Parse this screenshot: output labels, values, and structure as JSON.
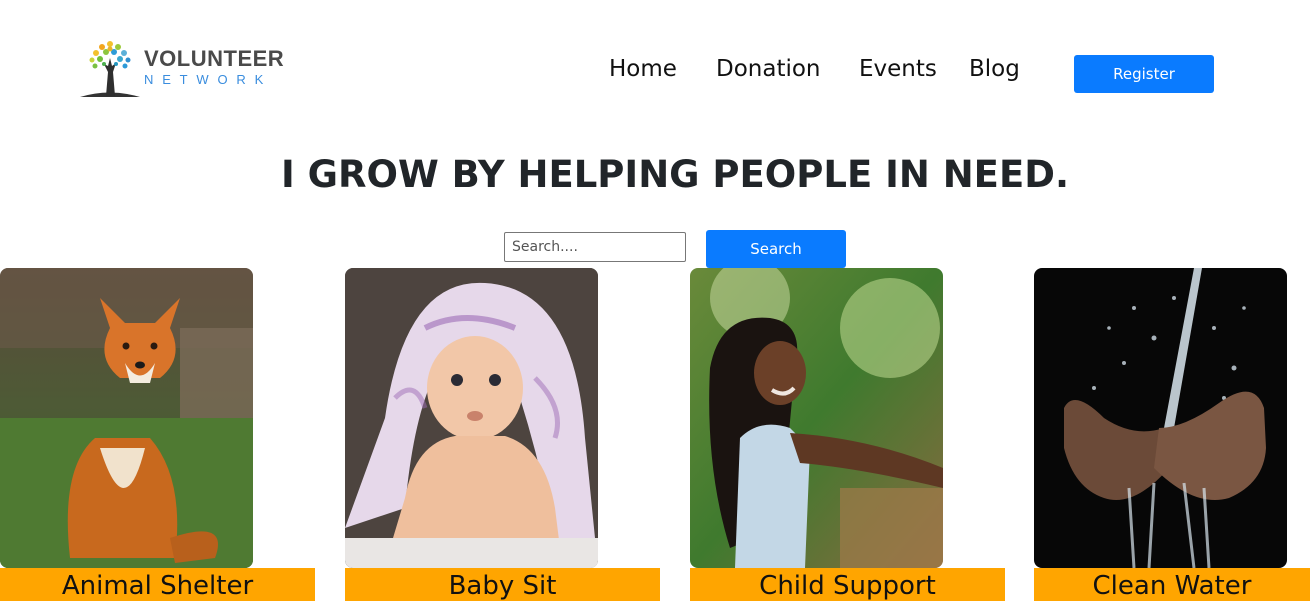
{
  "brand": {
    "title": "VOLUNTEER",
    "subtitle": "NETWORK",
    "icon": "tree-icon"
  },
  "nav": {
    "items": [
      {
        "label": "Home"
      },
      {
        "label": "Donation"
      },
      {
        "label": "Events"
      },
      {
        "label": "Blog"
      }
    ],
    "register_label": "Register"
  },
  "hero": {
    "title": "I GROW BY HELPING PEOPLE IN NEED."
  },
  "search": {
    "placeholder": "Search....",
    "button_label": "Search"
  },
  "cards": [
    {
      "label": "Animal Shelter",
      "image": "fox-photo"
    },
    {
      "label": "Baby Sit",
      "image": "baby-photo"
    },
    {
      "label": "Child Support",
      "image": "girl-photo"
    },
    {
      "label": "Clean Water",
      "image": "water-hands-photo"
    }
  ],
  "colors": {
    "primary": "#0a7bff",
    "card_label_bg": "#ffa500"
  }
}
